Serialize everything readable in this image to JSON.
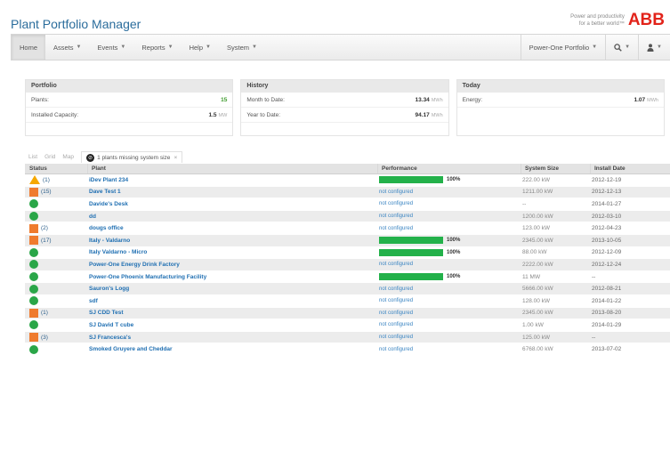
{
  "app": {
    "title": "Plant Portfolio Manager",
    "tagline_line1": "Power and productivity",
    "tagline_line2": "for a better world™",
    "logo": "ABB"
  },
  "nav": {
    "home": "Home",
    "assets": "Assets",
    "events": "Events",
    "reports": "Reports",
    "help": "Help",
    "system": "System",
    "portfolio": "Power-One Portfolio",
    "search_icon": "search-icon",
    "user_icon": "user-icon"
  },
  "summary": {
    "portfolio": {
      "heading": "Portfolio",
      "plants_label": "Plants:",
      "plants_value": "15",
      "capacity_label": "Installed Capacity:",
      "capacity_value": "1.5",
      "capacity_unit": "MW"
    },
    "history": {
      "heading": "History",
      "mtd_label": "Month to Date:",
      "mtd_value": "13.34",
      "mtd_unit": "MWh",
      "ytd_label": "Year to Date:",
      "ytd_value": "94.17",
      "ytd_unit": "MWh"
    },
    "today": {
      "heading": "Today",
      "energy_label": "Energy:",
      "energy_value": "1.07",
      "energy_unit": "MWh"
    }
  },
  "view_tabs": {
    "list": "List",
    "grid": "Grid",
    "map": "Map",
    "filter": "1 plants missing system size",
    "filter_close": "×"
  },
  "grid": {
    "headers": {
      "status": "Status",
      "plant": "Plant",
      "performance": "Performance",
      "system_size": "System Size",
      "install_date": "Install Date"
    },
    "rows": [
      {
        "status": "warning",
        "count": "(1)",
        "plant": "iDev Plant 234",
        "perf": "100%",
        "size": "222.00 kW",
        "date": "2012-12-19"
      },
      {
        "status": "alert",
        "count": "(15)",
        "plant": "Dave Test 1",
        "perf": "not configured",
        "size": "1211.00 kW",
        "date": "2012-12-13"
      },
      {
        "status": "ok",
        "count": "",
        "plant": "Davide's Desk",
        "perf": "not configured",
        "size": "--",
        "date": "2014-01-27"
      },
      {
        "status": "ok",
        "count": "",
        "plant": "dd",
        "perf": "not configured",
        "size": "1200.00 kW",
        "date": "2012-03-10"
      },
      {
        "status": "alert",
        "count": "(2)",
        "plant": "dougs office",
        "perf": "not configured",
        "size": "123.00 kW",
        "date": "2012-04-23"
      },
      {
        "status": "alert",
        "count": "(17)",
        "plant": "Italy - Valdarno",
        "perf": "100%",
        "size": "2345.00 kW",
        "date": "2013-10-05"
      },
      {
        "status": "ok",
        "count": "",
        "plant": "Italy Valdarno - Micro",
        "perf": "100%",
        "size": "88.00 kW",
        "date": "2012-12-09"
      },
      {
        "status": "ok",
        "count": "",
        "plant": "Power-One Energy Drink Factory",
        "perf": "not configured",
        "size": "2222.00 kW",
        "date": "2012-12-24"
      },
      {
        "status": "ok",
        "count": "",
        "plant": "Power-One Phoenix Manufacturing Facility",
        "perf": "100%",
        "size": "11 MW",
        "date": "--"
      },
      {
        "status": "ok",
        "count": "",
        "plant": "Sauron's Logg",
        "perf": "not configured",
        "size": "5666.00 kW",
        "date": "2012-08-21"
      },
      {
        "status": "ok",
        "count": "",
        "plant": "sdf",
        "perf": "not configured",
        "size": "128.00 kW",
        "date": "2014-01-22"
      },
      {
        "status": "alert",
        "count": "(1)",
        "plant": "SJ CDD Test",
        "perf": "not configured",
        "size": "2345.00 kW",
        "date": "2013-08-20"
      },
      {
        "status": "ok",
        "count": "",
        "plant": "SJ David T cube",
        "perf": "not configured",
        "size": "1.00 kW",
        "date": "2014-01-29"
      },
      {
        "status": "alert",
        "count": "(3)",
        "plant": "SJ Francesca's",
        "perf": "not configured",
        "size": "125.00 kW",
        "date": "--"
      },
      {
        "status": "ok",
        "count": "",
        "plant": "Smoked Gruyere and Cheddar",
        "perf": "not configured",
        "size": "6768.00 kW",
        "date": "2013-07-02"
      }
    ]
  },
  "colors": {
    "ok": "#2aa648",
    "alert": "#ef7b2e",
    "warning": "#f5a800",
    "performance_bar": "#23b14a",
    "link": "#1f6fb2"
  }
}
